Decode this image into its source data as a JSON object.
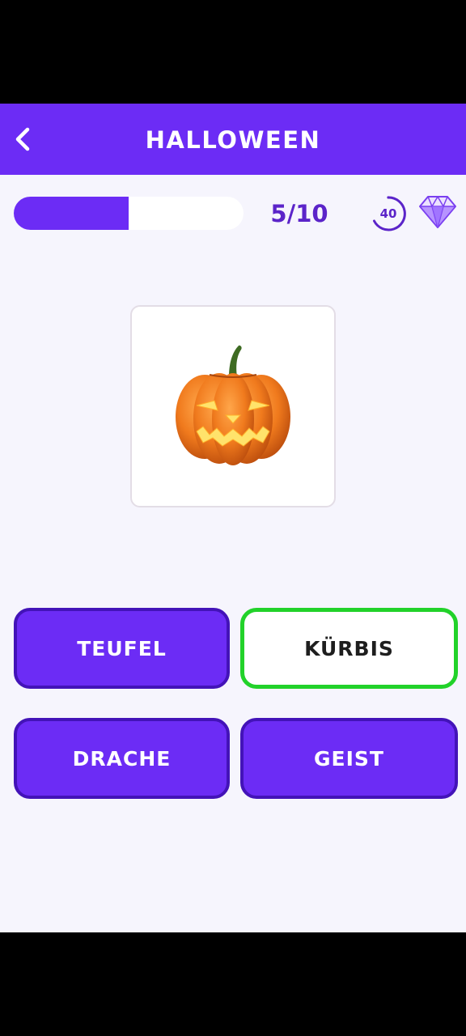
{
  "header": {
    "title": "HALLOWEEN",
    "back_icon": "chevron-left-icon",
    "background_color": "#6c2cf5"
  },
  "progress": {
    "label": "5/10",
    "current": 5,
    "total": 10,
    "fraction": 0.5,
    "fill_color": "#6c2cf5"
  },
  "timer": {
    "value": "40",
    "icon": "countdown-timer-icon"
  },
  "rewards": {
    "icon": "diamond-icon"
  },
  "question": {
    "image": "jack-o-lantern-pumpkin-image"
  },
  "answers": [
    {
      "label": "TEUFEL",
      "state": "default"
    },
    {
      "label": "KÜRBIS",
      "state": "correct"
    },
    {
      "label": "DRACHE",
      "state": "default"
    },
    {
      "label": "GEIST",
      "state": "default"
    }
  ],
  "colors": {
    "accent": "#6c2cf5",
    "accent_dark": "#4313b8",
    "correct": "#22d22a",
    "background": "#f6f5fd"
  }
}
